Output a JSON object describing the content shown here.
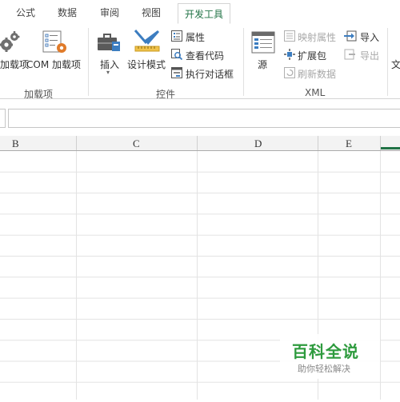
{
  "tabs": [
    "公式",
    "数据",
    "审阅",
    "视图",
    "开发工具"
  ],
  "active_tab": "开发工具",
  "ribbon": {
    "addins": {
      "label": "加载项",
      "addins_button": "加载项",
      "com_addins_button": "COM 加载项"
    },
    "controls": {
      "label": "控件",
      "insert_button": "插入",
      "design_mode_button": "设计模式",
      "properties_button": "属性",
      "view_code_button": "查看代码",
      "run_dialog_button": "执行对话框"
    },
    "xml": {
      "label": "XML",
      "source_button": "源",
      "map_properties_button": "映射属性",
      "expansion_packs_button": "扩展包",
      "refresh_data_button": "刷新数据",
      "import_button": "导入",
      "export_button": "导出"
    },
    "document_partial": "文"
  },
  "columns": [
    "B",
    "C",
    "D",
    "E"
  ],
  "watermark": {
    "title": "百科全说",
    "subtitle": "助你轻松解决"
  },
  "colors": {
    "accent": "#217346",
    "watermark_green": "#2e9b3e",
    "gridline": "#e3e3e3"
  }
}
